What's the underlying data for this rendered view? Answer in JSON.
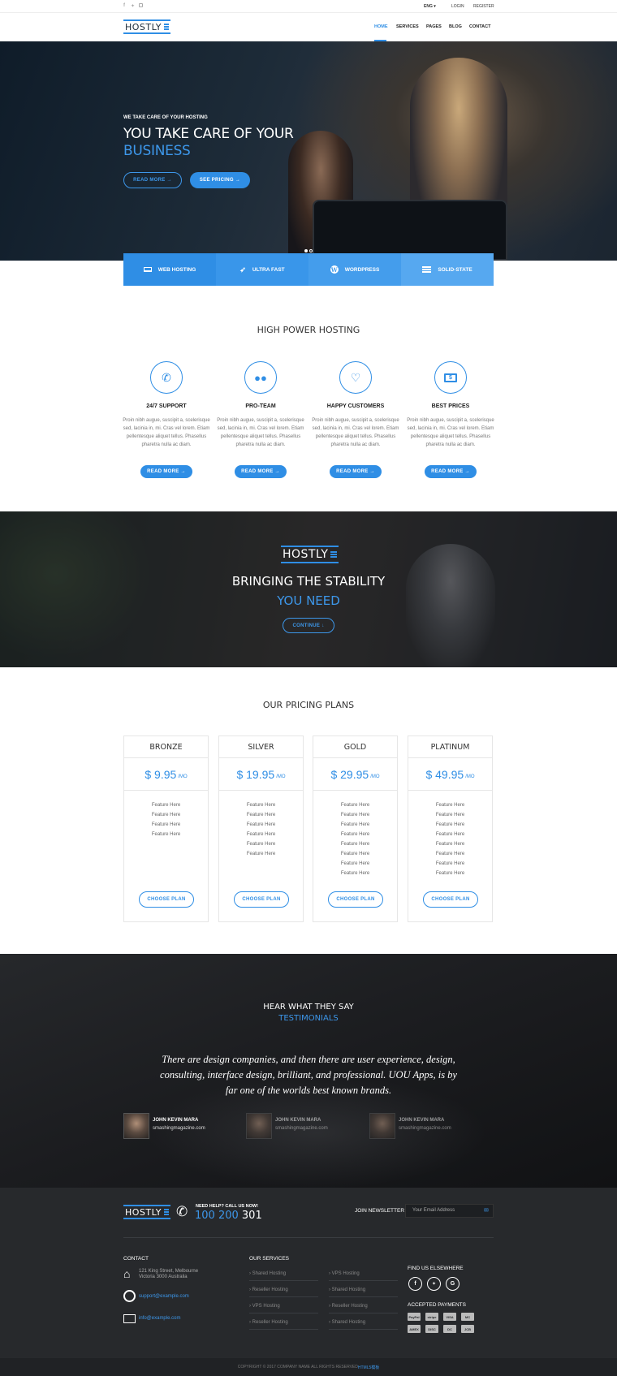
{
  "topbar": {
    "social": [
      "facebook-icon",
      "twitter-icon",
      "instagram-icon"
    ],
    "lang": "ENG ▾",
    "login": "LOGIN",
    "register": "REGISTER"
  },
  "brand": {
    "name": "HOSTLY"
  },
  "nav": {
    "items": [
      "HOME",
      "SERVICES",
      "PAGES",
      "BLOG",
      "CONTACT"
    ],
    "active": "HOME"
  },
  "hero": {
    "kicker": "WE TAKE CARE OF YOUR HOSTING",
    "title_line1": "YOU TAKE CARE OF YOUR",
    "title_line2": "BUSINESS",
    "read_more": "READ MORE →",
    "see_pricing": "SEE PRICING →"
  },
  "service_tabs": [
    {
      "label": "WEB HOSTING",
      "icon": "laptop-icon"
    },
    {
      "label": "ULTRA FAST",
      "icon": "rocket-icon"
    },
    {
      "label": "WORDPRESS",
      "icon": "wordpress-icon"
    },
    {
      "label": "SOLID-STATE",
      "icon": "server-icon"
    }
  ],
  "features": {
    "heading": "HIGH POWER HOSTING",
    "items": [
      {
        "title": "24/7 SUPPORT",
        "icon": "phone-icon",
        "text": "Proin nibh augue, suscipit a, scelerisque sed, lacinia in, mi. Cras vel lorem. Etiam pellentesque aliquet tellus. Phasellus pharetra nulla ac diam.",
        "button": "READ MORE →"
      },
      {
        "title": "PRO-TEAM",
        "icon": "team-icon",
        "text": "Proin nibh augue, suscipit a, scelerisque sed, lacinia in, mi. Cras vel lorem. Etiam pellentesque aliquet tellus. Phasellus pharetra nulla ac diam.",
        "button": "READ MORE →"
      },
      {
        "title": "HAPPY CUSTOMERS",
        "icon": "heart-icon",
        "text": "Proin nibh augue, suscipit a, scelerisque sed, lacinia in, mi. Cras vel lorem. Etiam pellentesque aliquet tellus. Phasellus pharetra nulla ac diam.",
        "button": "READ MORE →"
      },
      {
        "title": "BEST PRICES",
        "icon": "money-icon",
        "text": "Proin nibh augue, suscipit a, scelerisque sed, lacinia in, mi. Cras vel lorem. Etiam pellentesque aliquet tellus. Phasellus pharetra nulla ac diam.",
        "button": "READ MORE →"
      }
    ]
  },
  "stability": {
    "line1": "BRINGING THE STABILITY",
    "line2": "YOU NEED",
    "button": "CONTINUE ↓"
  },
  "pricing": {
    "heading": "OUR PRICING PLANS",
    "plans": [
      {
        "name": "BRONZE",
        "price": "$ 9.95",
        "period": "/MO",
        "features": [
          "Feature Here",
          "Feature Here",
          "Feature Here",
          "Feature Here"
        ],
        "button": "CHOOSE PLAN"
      },
      {
        "name": "SILVER",
        "price": "$ 19.95",
        "period": "/MO",
        "features": [
          "Feature Here",
          "Feature Here",
          "Feature Here",
          "Feature Here",
          "Feature Here",
          "Feature Here"
        ],
        "button": "CHOOSE PLAN"
      },
      {
        "name": "GOLD",
        "price": "$ 29.95",
        "period": "/MO",
        "features": [
          "Feature Here",
          "Feature Here",
          "Feature Here",
          "Feature Here",
          "Feature Here",
          "Feature Here",
          "Feature Here",
          "Feature Here"
        ],
        "button": "CHOOSE PLAN"
      },
      {
        "name": "PLATINUM",
        "price": "$ 49.95",
        "period": "/MO",
        "features": [
          "Feature Here",
          "Feature Here",
          "Feature Here",
          "Feature Here",
          "Feature Here",
          "Feature Here",
          "Feature Here",
          "Feature Here"
        ],
        "button": "CHOOSE PLAN"
      }
    ]
  },
  "testimonials": {
    "kicker": "HEAR WHAT THEY SAY",
    "heading": "TESTIMONIALS",
    "quote": "There are design companies, and then there are user experience, design, consulting, interface design, brilliant, and professional. UOU Apps, is by far one of the worlds best known brands.",
    "authors": [
      {
        "name": "JOHN KEVIN MARA",
        "site": "smashingmagazine.com"
      },
      {
        "name": "JOHN KEVIN MARA",
        "site": "smashingmagazine.com"
      },
      {
        "name": "JOHN KEVIN MARA",
        "site": "smashingmagazine.com"
      }
    ]
  },
  "footer": {
    "help_label": "NEED HELP? CALL US NOW!",
    "phone_main": "100 200",
    "phone_tail": "301",
    "newsletter_label": "JOIN NEWSLETTER",
    "newsletter_placeholder": "Your Email Address",
    "contact_title": "CONTACT",
    "address": "121 King Street, Melbourne Victoria 3000 Australia",
    "support_email": "support@example.com",
    "info_email": "info@example.com",
    "services_title": "OUR SERVICES",
    "services_col1": [
      "Shared Hosting",
      "Reseller Hosting",
      "VPS Hosting",
      "Reseller Hosting"
    ],
    "services_col2": [
      "VPS Hosting",
      "Shared Hosting",
      "Reseller Hosting",
      "Shared Hosting"
    ],
    "social_title": "FIND US ELSEWHERE",
    "social": [
      "facebook-icon",
      "twitter-icon",
      "google-icon"
    ],
    "payments_title": "ACCEPTED PAYMENTS",
    "payments": [
      "PayPal",
      "stripe",
      "VISA",
      "MC",
      "AMEX",
      "DISC",
      "DC",
      "JCB"
    ],
    "copyright": "COPYRIGHT © 2017 COMPANY NAME ALL RIGHTS RESERVED ",
    "copyright_link": "HTML5模板"
  },
  "colors": {
    "accent": "#2f8ee5",
    "dark": "#1c1e21",
    "footer_bg": "#27292c"
  }
}
